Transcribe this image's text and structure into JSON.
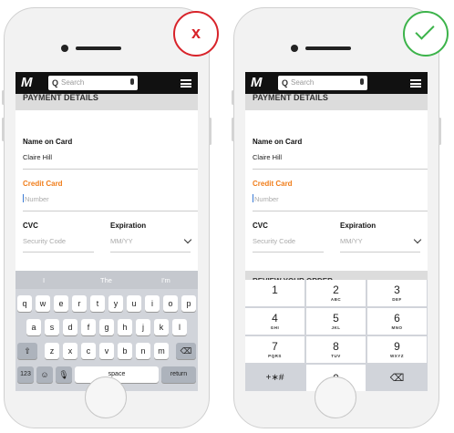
{
  "header": {
    "logo": "M",
    "search_placeholder": "Search"
  },
  "payment": {
    "section_title": "PAYMENT DETAILS",
    "name_label": "Name on Card",
    "name_value": "Claire Hill",
    "card_label": "Credit Card",
    "card_placeholder": "Number",
    "cvc_label": "CVC",
    "cvc_placeholder": "Security Code",
    "exp_label": "Expiration",
    "exp_placeholder": "MM/YY"
  },
  "review_title": "REVIEW YOUR ORDER",
  "keyboard": {
    "suggestions": [
      "I",
      "The",
      "I'm"
    ],
    "row1": [
      "q",
      "w",
      "e",
      "r",
      "t",
      "y",
      "u",
      "i",
      "o",
      "p"
    ],
    "row2": [
      "a",
      "s",
      "d",
      "f",
      "g",
      "h",
      "j",
      "k",
      "l"
    ],
    "row3": [
      "z",
      "x",
      "c",
      "v",
      "b",
      "n",
      "m"
    ],
    "numbers_key": "123",
    "space_key": "space",
    "return_key": "return"
  },
  "numpad": {
    "keys": [
      {
        "digit": "1",
        "letters": ""
      },
      {
        "digit": "2",
        "letters": "ABC"
      },
      {
        "digit": "3",
        "letters": "DEF"
      },
      {
        "digit": "4",
        "letters": "GHI"
      },
      {
        "digit": "5",
        "letters": "JKL"
      },
      {
        "digit": "6",
        "letters": "MNO"
      },
      {
        "digit": "7",
        "letters": "PQRS"
      },
      {
        "digit": "8",
        "letters": "TUV"
      },
      {
        "digit": "9",
        "letters": "WXYZ"
      }
    ],
    "symbols_key": "+∗#",
    "zero_key": "0"
  },
  "verdicts": {
    "bad": "x",
    "good_icon": "checkmark-icon"
  },
  "colors": {
    "bad": "#d8232a",
    "good": "#3cb34a",
    "accent": "#f07d1a"
  }
}
